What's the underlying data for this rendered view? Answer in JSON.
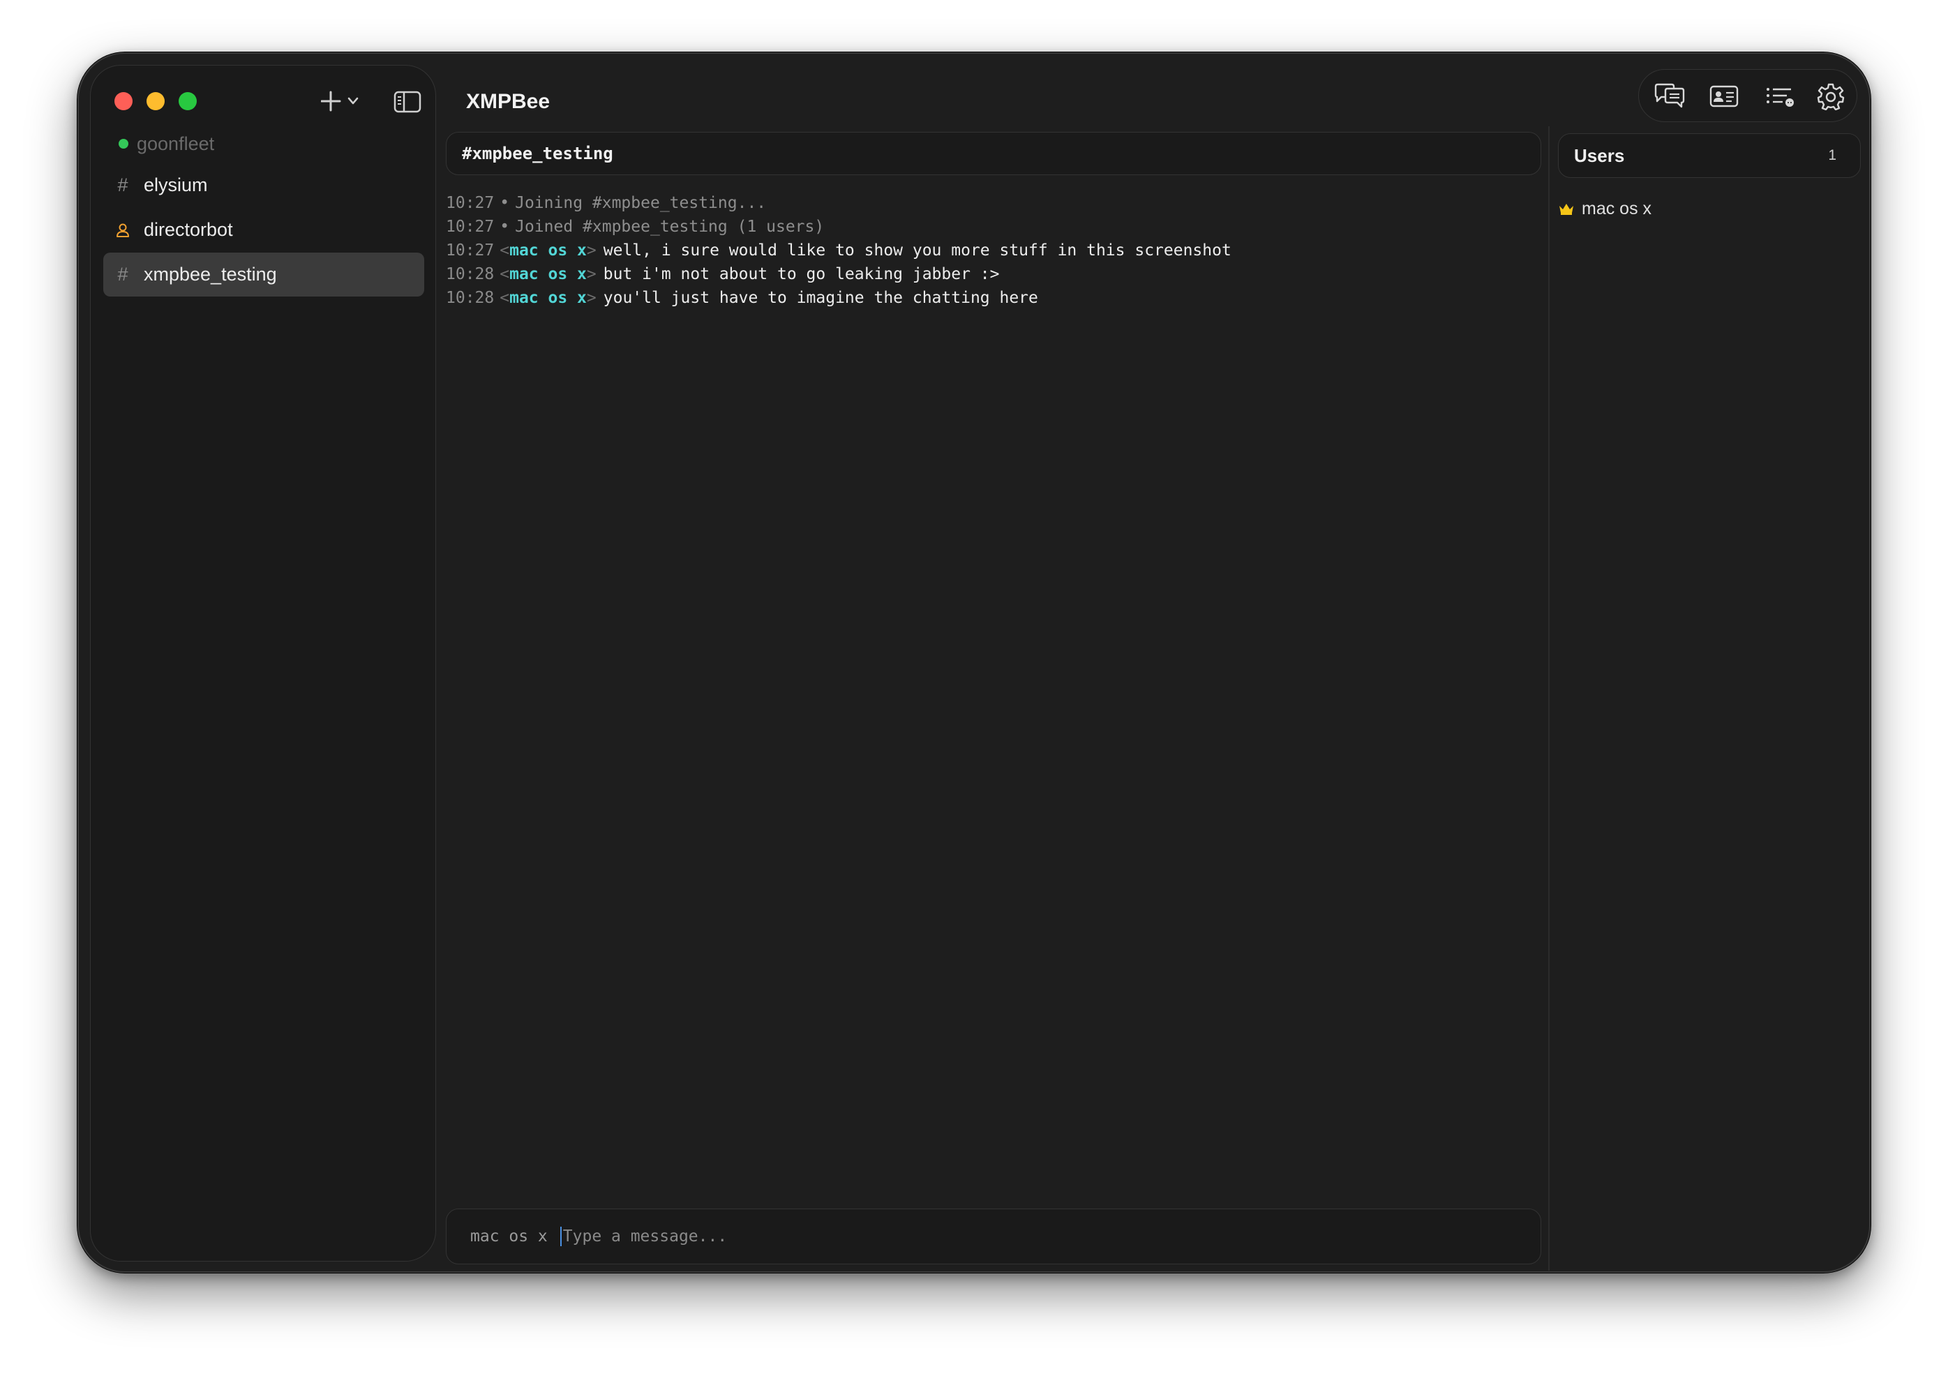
{
  "window": {
    "title": "XMPBee"
  },
  "sidebar": {
    "server": {
      "name": "goonfleet",
      "status_color": "#34c759"
    },
    "items": [
      {
        "label": "elysium",
        "icon": "hash-icon",
        "active": false
      },
      {
        "label": "directorbot",
        "icon": "person-icon",
        "active": false
      },
      {
        "label": "xmpbee_testing",
        "icon": "hash-icon",
        "active": true
      }
    ]
  },
  "toolbar": {
    "icons": [
      "chat-bubbles-icon",
      "contact-card-icon",
      "list-icon",
      "gear-icon"
    ]
  },
  "channel": {
    "title": "#xmpbee_testing",
    "messages": [
      {
        "time": "10:27",
        "type": "system",
        "text": "Joining #xmpbee_testing..."
      },
      {
        "time": "10:27",
        "type": "system",
        "text": "Joined #xmpbee_testing (1 users)"
      },
      {
        "time": "10:27",
        "type": "chat",
        "nick": "mac os x",
        "text": "well, i sure would like to show you more stuff in this screenshot"
      },
      {
        "time": "10:28",
        "type": "chat",
        "nick": "mac os x",
        "text": "but i'm not about to go leaking jabber :>"
      },
      {
        "time": "10:28",
        "type": "chat",
        "nick": "mac os x",
        "text": "you'll just have to imagine the chatting here"
      }
    ]
  },
  "composer": {
    "nick": "mac os x",
    "placeholder": "Type a message..."
  },
  "users": {
    "header": "Users",
    "count": "1",
    "list": [
      {
        "name": "mac os x",
        "role_icon": "crown-icon"
      }
    ]
  },
  "colors": {
    "accent_nick": "#52d5d5",
    "crown": "#f5c518",
    "person_icon": "#f0a030"
  }
}
